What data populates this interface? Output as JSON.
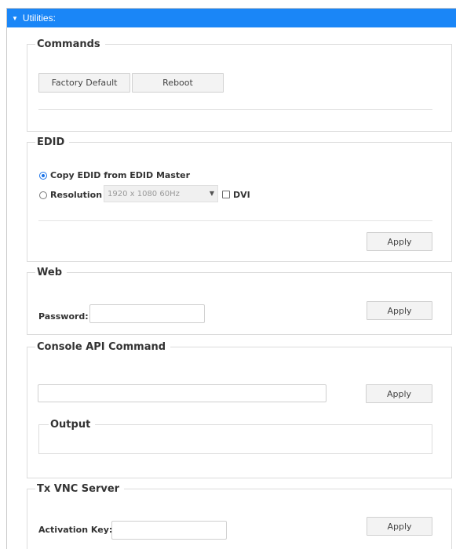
{
  "header": {
    "title": "Utilities:",
    "caret_icon": "caret-down-icon"
  },
  "commands": {
    "legend": "Commands",
    "factory_default_label": "Factory Default",
    "reboot_label": "Reboot"
  },
  "edid": {
    "legend": "EDID",
    "copy_option_label": "Copy EDID from EDID Master",
    "resolution_label": "Resolution",
    "resolution_value": "1920 x 1080 60Hz",
    "dvi_label": "DVI",
    "copy_selected": true,
    "dvi_checked": false,
    "apply_label": "Apply"
  },
  "web": {
    "legend": "Web",
    "password_label": "Password:",
    "password_value": "",
    "apply_label": "Apply"
  },
  "console": {
    "legend": "Console API Command",
    "command_value": "",
    "apply_label": "Apply",
    "output_legend": "Output",
    "output_text": ""
  },
  "vnc": {
    "legend": "Tx VNC Server",
    "activation_label": "Activation Key:",
    "activation_value": "",
    "apply_label": "Apply"
  },
  "colors": {
    "header_bg": "#1a86f7",
    "radio_accent": "#1a73e8"
  }
}
